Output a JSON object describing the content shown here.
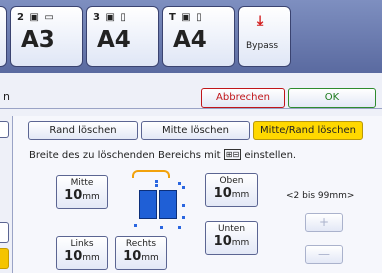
{
  "trays": [
    {
      "id": "stub",
      "icons": "▯",
      "size": ""
    },
    {
      "id": "tray2",
      "icons": "2 ▣ ▭",
      "size": "A3"
    },
    {
      "id": "tray3",
      "icons": "3 ▣ ▯",
      "size": "A4"
    },
    {
      "id": "trayT",
      "icons": "T ▣ ▯",
      "size": "A4"
    }
  ],
  "bypass": {
    "icon": "⤓",
    "label": "Bypass"
  },
  "action_bar": {
    "left_fragment": "n",
    "cancel": "Abbrechen",
    "ok": "OK"
  },
  "tabs": {
    "rand": "Rand löschen",
    "mitte": "Mitte löschen",
    "mitte_rand": "Mitte/Rand löschen"
  },
  "hint": {
    "before": "Breite des zu löschenden Bereichs mit",
    "keys": "⊞⊟",
    "after": "einstellen."
  },
  "values": {
    "mitte": {
      "label": "Mitte",
      "value": "10",
      "unit": "mm"
    },
    "oben": {
      "label": "Oben",
      "value": "10",
      "unit": "mm"
    },
    "unten": {
      "label": "Unten",
      "value": "10",
      "unit": "mm"
    },
    "links": {
      "label": "Links",
      "value": "10",
      "unit": "mm"
    },
    "rechts": {
      "label": "Rechts",
      "value": "10",
      "unit": "mm"
    }
  },
  "range": "<2 bis 99mm>",
  "stepper": {
    "plus": "+",
    "minus": "—"
  }
}
